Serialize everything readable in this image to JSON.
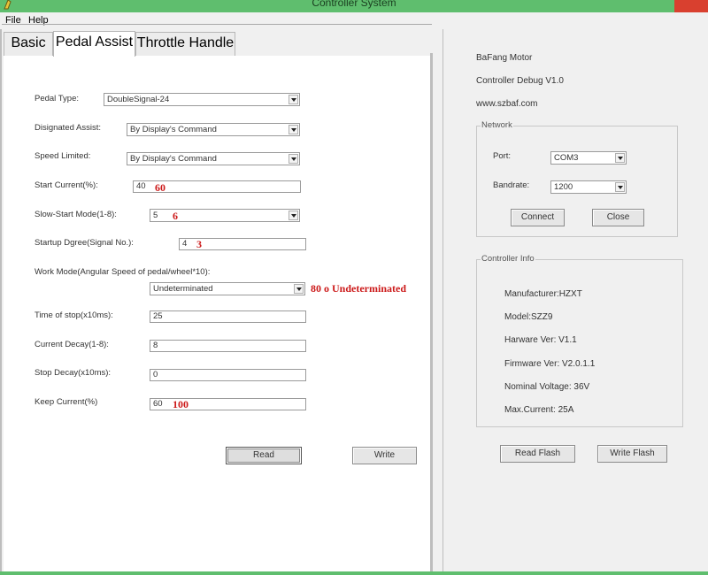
{
  "window": {
    "title": "Controller System"
  },
  "menu": {
    "file": "File",
    "help": "Help"
  },
  "tabs": [
    {
      "label": "Basic"
    },
    {
      "label": "Pedal Assist"
    },
    {
      "label": "Throttle Handle"
    }
  ],
  "form": {
    "pedal_type": {
      "label": "Pedal Type:",
      "value": "DoubleSignal-24"
    },
    "designated_assist": {
      "label": "Disignated Assist:",
      "value": "By Display's Command"
    },
    "speed_limited": {
      "label": "Speed Limited:",
      "value": "By Display's Command"
    },
    "start_current": {
      "label": "Start Current(%):",
      "value": "40",
      "note": "60"
    },
    "slow_start": {
      "label": "Slow-Start Mode(1-8):",
      "value": "5",
      "note": "6"
    },
    "startup_degree": {
      "label": "Startup Dgree(Signal No.):",
      "value": "4",
      "note": "3"
    },
    "work_mode": {
      "label": "Work Mode(Angular Speed of pedal/wheel*10):",
      "value": "Undeterminated",
      "note": "80 o Undeterminated"
    },
    "time_of_stop": {
      "label": "Time of stop(x10ms):",
      "value": "25"
    },
    "current_decay": {
      "label": "Current Decay(1-8):",
      "value": "8"
    },
    "stop_decay": {
      "label": "Stop Decay(x10ms):",
      "value": "0"
    },
    "keep_current": {
      "label": "Keep Current(%)",
      "value": "60",
      "note": "100"
    }
  },
  "buttons": {
    "read": "Read",
    "write": "Write",
    "connect": "Connect",
    "close": "Close",
    "read_flash": "Read Flash",
    "write_flash": "Write Flash"
  },
  "about": {
    "company": "BaFang Motor",
    "version": "Controller Debug V1.0",
    "website": "www.szbaf.com"
  },
  "network": {
    "title": "Network",
    "port_label": "Port:",
    "port_value": "COM3",
    "baud_label": "Bandrate:",
    "baud_value": "1200"
  },
  "controller_info": {
    "title": "Controller Info",
    "manufacturer": "Manufacturer:HZXT",
    "model": "Model:SZZ9",
    "hardware": "Harware Ver: V1.1",
    "firmware": "Firmware Ver: V2.0.1.1",
    "voltage": "Nominal Voltage: 36V",
    "max_current": "Max.Current: 25A"
  },
  "colors": {
    "titlebar": "#5fbe6e",
    "annotation": "#cc1a1a",
    "close": "#d9402f"
  }
}
